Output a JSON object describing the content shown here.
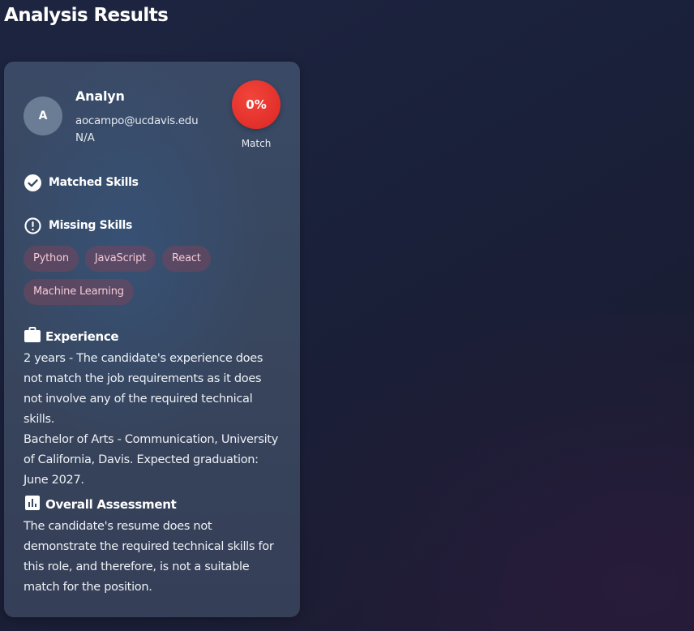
{
  "page": {
    "title": "Analysis Results"
  },
  "candidate": {
    "avatar_initial": "A",
    "name": "Analyn",
    "email": "aocampo@ucdavis.edu",
    "phone": "N/A",
    "match_percent": "0%",
    "match_label": "Match",
    "match_color": "#e22f2a"
  },
  "matched_skills": {
    "heading": "Matched Skills",
    "icon": "check-circle-icon",
    "items": []
  },
  "missing_skills": {
    "heading": "Missing Skills",
    "icon": "exclamation-circle-icon",
    "items": [
      "Python",
      "JavaScript",
      "React",
      "Machine Learning"
    ]
  },
  "experience": {
    "heading": "Experience",
    "icon": "briefcase-icon",
    "summary": "2 years - The candidate's experience does not match the job requirements as it does not involve any of the required technical skills.",
    "education": "Bachelor of Arts - Communication, University of California, Davis. Expected graduation: June 2027."
  },
  "assessment": {
    "heading": "Overall Assessment",
    "icon": "bar-chart-icon",
    "text": "The candidate's resume does not demonstrate the required technical skills for this role, and therefore, is not a suitable match for the position."
  },
  "colors": {
    "missing_chip_bg": "#78465c",
    "missing_chip_text": "#f5c9d3",
    "card_bg": "#38465e"
  }
}
